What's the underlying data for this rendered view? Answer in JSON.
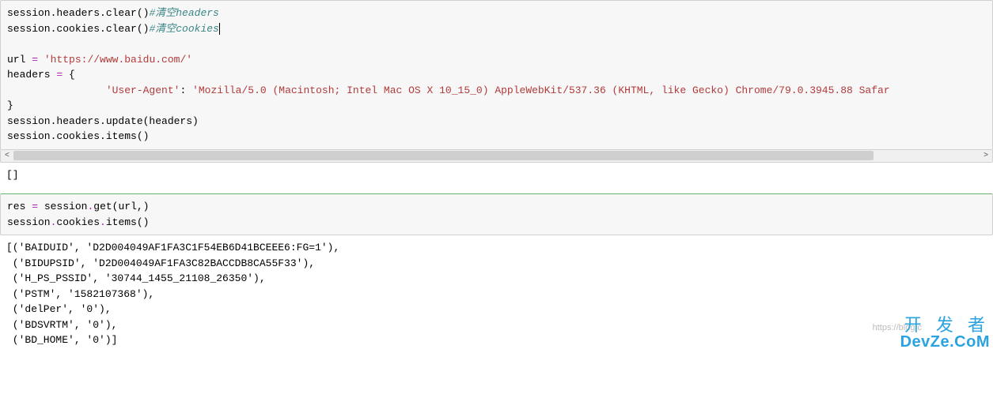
{
  "cell1": {
    "line1": {
      "code": "session.headers.clear()",
      "comment": "#清空headers"
    },
    "line2": {
      "code": "session.cookies.clear()",
      "comment": "#清空cookies"
    },
    "blank": "",
    "url_lhs": "url ",
    "url_eq": "=",
    "url_val": " 'https://www.baidu.com/'",
    "hdr_lhs": "headers ",
    "hdr_eq": "=",
    "hdr_brace": " {",
    "ua_indent": "                ",
    "ua_key": "'User-Agent'",
    "ua_colon": ": ",
    "ua_val": "'Mozilla/5.0 (Macintosh; Intel Mac OS X 10_15_0) AppleWebKit/537.36 (KHTML, like Gecko) Chrome/79.0.3945.88 Safar",
    "close_brace": "}",
    "upd": "session.headers.update(headers)",
    "items": "session.cookies.items()"
  },
  "out1": "[]",
  "cell2": {
    "l1a": "res ",
    "l1eq": "=",
    "l1b": " session",
    "l1dot": ".",
    "l1get": "get",
    "l1p": "(url,)",
    "l2a": "session",
    "l2dot1": ".",
    "l2b": "cookies",
    "l2dot2": ".",
    "l2c": "items",
    "l2p": "()"
  },
  "out2": "[('BAIDUID', 'D2D004049AF1FA3C1F54EB6D41BCEEE6:FG=1'),\n ('BIDUPSID', 'D2D004049AF1FA3C82BACCDB8CA55F33'),\n ('H_PS_PSSID', '30744_1455_21108_26350'),\n ('PSTM', '1582107368'),\n ('delPer', '0'),\n ('BDSVRTM', '0'),\n ('BD_HOME', '0')]",
  "scroll": {
    "left": "<",
    "right": ">"
  },
  "watermark": {
    "faint": "https://blog.c",
    "top": "开 发 者",
    "bot": "DevZe.CoM"
  }
}
